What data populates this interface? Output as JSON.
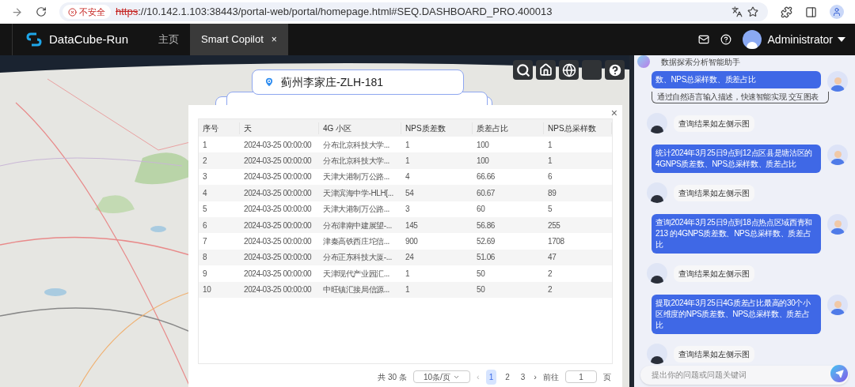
{
  "browser": {
    "security": "不安全",
    "url_scheme": "https",
    "url_rest": "://10.142.1.103:38443/portal-web/portal/homepage.html#SEQ.DASHBOARD_PRO.400013"
  },
  "app": {
    "brand": "DataCube-Run",
    "tabs": [
      {
        "label": "主页",
        "selected": false,
        "closable": false
      },
      {
        "label": "Smart Copilot",
        "selected": true,
        "closable": true
      }
    ],
    "close_glyph": "×",
    "user": "Administrator"
  },
  "map": {
    "popup": "蓟州李家庄-ZLH-181"
  },
  "modal": {
    "close": "×",
    "columns": [
      "序号",
      "天",
      "4G 小区",
      "NPS质差数",
      "质差占比",
      "NPS总采样数"
    ],
    "rows": [
      [
        "1",
        "2024-03-25 00:00:00",
        "分布北京科技大学...",
        "1",
        "100",
        "1"
      ],
      [
        "2",
        "2024-03-25 00:00:00",
        "分布北京科技大学...",
        "1",
        "100",
        "1"
      ],
      [
        "3",
        "2024-03-25 00:00:00",
        "天津大港制万公路...",
        "4",
        "66.66",
        "6"
      ],
      [
        "4",
        "2024-03-25 00:00:00",
        "天津滨海中学-HLH[...",
        "54",
        "60.67",
        "89"
      ],
      [
        "5",
        "2024-03-25 00:00:00",
        "天津大港制万公路...",
        "3",
        "60",
        "5"
      ],
      [
        "6",
        "2024-03-25 00:00:00",
        "分布津南中建展望-...",
        "145",
        "56.86",
        "255"
      ],
      [
        "7",
        "2024-03-25 00:00:00",
        "津秦高铁西庄坨信...",
        "900",
        "52.69",
        "1708"
      ],
      [
        "8",
        "2024-03-25 00:00:00",
        "分布正东科技大厦-...",
        "24",
        "51.06",
        "47"
      ],
      [
        "9",
        "2024-03-25 00:00:00",
        "天津现代产业园汇...",
        "1",
        "50",
        "2"
      ],
      [
        "10",
        "2024-03-25 00:00:00",
        "中旺镇汇接局信源...",
        "1",
        "50",
        "2"
      ]
    ],
    "pagination": {
      "total": "共 30 条",
      "page_size": "10条/页",
      "prev": "‹",
      "pages": [
        {
          "label": "1",
          "selected": true
        },
        {
          "label": "2",
          "selected": false
        },
        {
          "label": "3",
          "selected": false
        }
      ],
      "next": "›",
      "goto": "前往",
      "goto_value": "1",
      "page_unit": "页"
    }
  },
  "chat": {
    "title": "数据探索分析智能助手",
    "messages": [
      {
        "kind": "user",
        "text": "数、NPS总采样数、质差占比"
      },
      {
        "kind": "hint",
        "text": "通过自然语言输入描述，快速智能实现 交互图表"
      },
      {
        "kind": "bot",
        "text": "查询结果如左侧示图"
      },
      {
        "kind": "user",
        "text": "统计2024年3月25日9点到12点区县是塘沽区的4GNPS质差数、NPS总采样数、质差占比"
      },
      {
        "kind": "bot",
        "text": "查询结果如左侧示图"
      },
      {
        "kind": "user",
        "text": "查询2024年3月25日9点到18点热点区域西青和213 的4GNPS质差数、NPS总采样数、质差占比"
      },
      {
        "kind": "bot",
        "text": "查询结果如左侧示图"
      },
      {
        "kind": "user",
        "text": "提取2024年3月25日4G质差占比最高的30个小区维度的NPS质差数、NPS总采样数、质差占比"
      },
      {
        "kind": "bot",
        "text": "查询结果如左侧示图"
      }
    ],
    "input": {
      "placeholder": "提出你的问题或问题关键词"
    }
  }
}
